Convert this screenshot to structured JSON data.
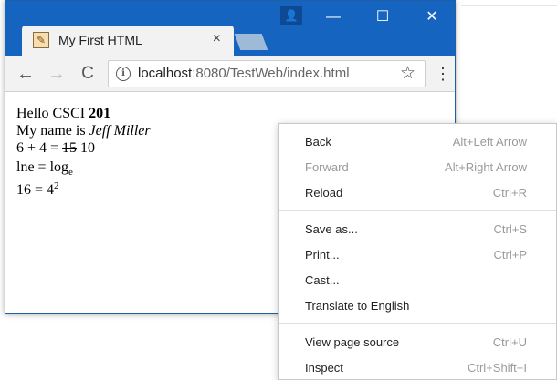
{
  "window": {
    "tab_title": "My First HTML",
    "tab_close": "×",
    "profile_glyph": "👤",
    "minimize_glyph": "—",
    "maximize_glyph": "☐",
    "close_glyph": "✕"
  },
  "toolbar": {
    "back_glyph": "←",
    "forward_glyph": "→",
    "reload_glyph": "C",
    "info_glyph": "i",
    "url_host": "localhost",
    "url_rest": ":8080/TestWeb/index.html",
    "star_glyph": "☆",
    "menu_glyph": "⋮"
  },
  "page": {
    "line1_text": "Hello CSCI ",
    "line1_bold": "201",
    "line2_text": "My name is ",
    "line2_italic": "Jeff Miller",
    "line3_text": "6 + 4 = ",
    "line3_strike": "15",
    "line3_tail": " 10",
    "line4_text": "lne = log",
    "line4_sub": "e",
    "line5_text": "16 = 4",
    "line5_sup": "2"
  },
  "context_menu": {
    "items": [
      {
        "label": "Back",
        "shortcut": "Alt+Left Arrow"
      },
      {
        "label": "Forward",
        "shortcut": "Alt+Right Arrow"
      },
      {
        "label": "Reload",
        "shortcut": "Ctrl+R"
      },
      {
        "label": "Save as...",
        "shortcut": "Ctrl+S"
      },
      {
        "label": "Print...",
        "shortcut": "Ctrl+P"
      },
      {
        "label": "Cast...",
        "shortcut": ""
      },
      {
        "label": "Translate to English",
        "shortcut": ""
      },
      {
        "label": "View page source",
        "shortcut": "Ctrl+U"
      },
      {
        "label": "Inspect",
        "shortcut": "Ctrl+Shift+I"
      }
    ]
  },
  "colors": {
    "titlebar": "#1565c0",
    "toolbar": "#f2f2f2",
    "disabled_text": "#9a9a9a"
  }
}
